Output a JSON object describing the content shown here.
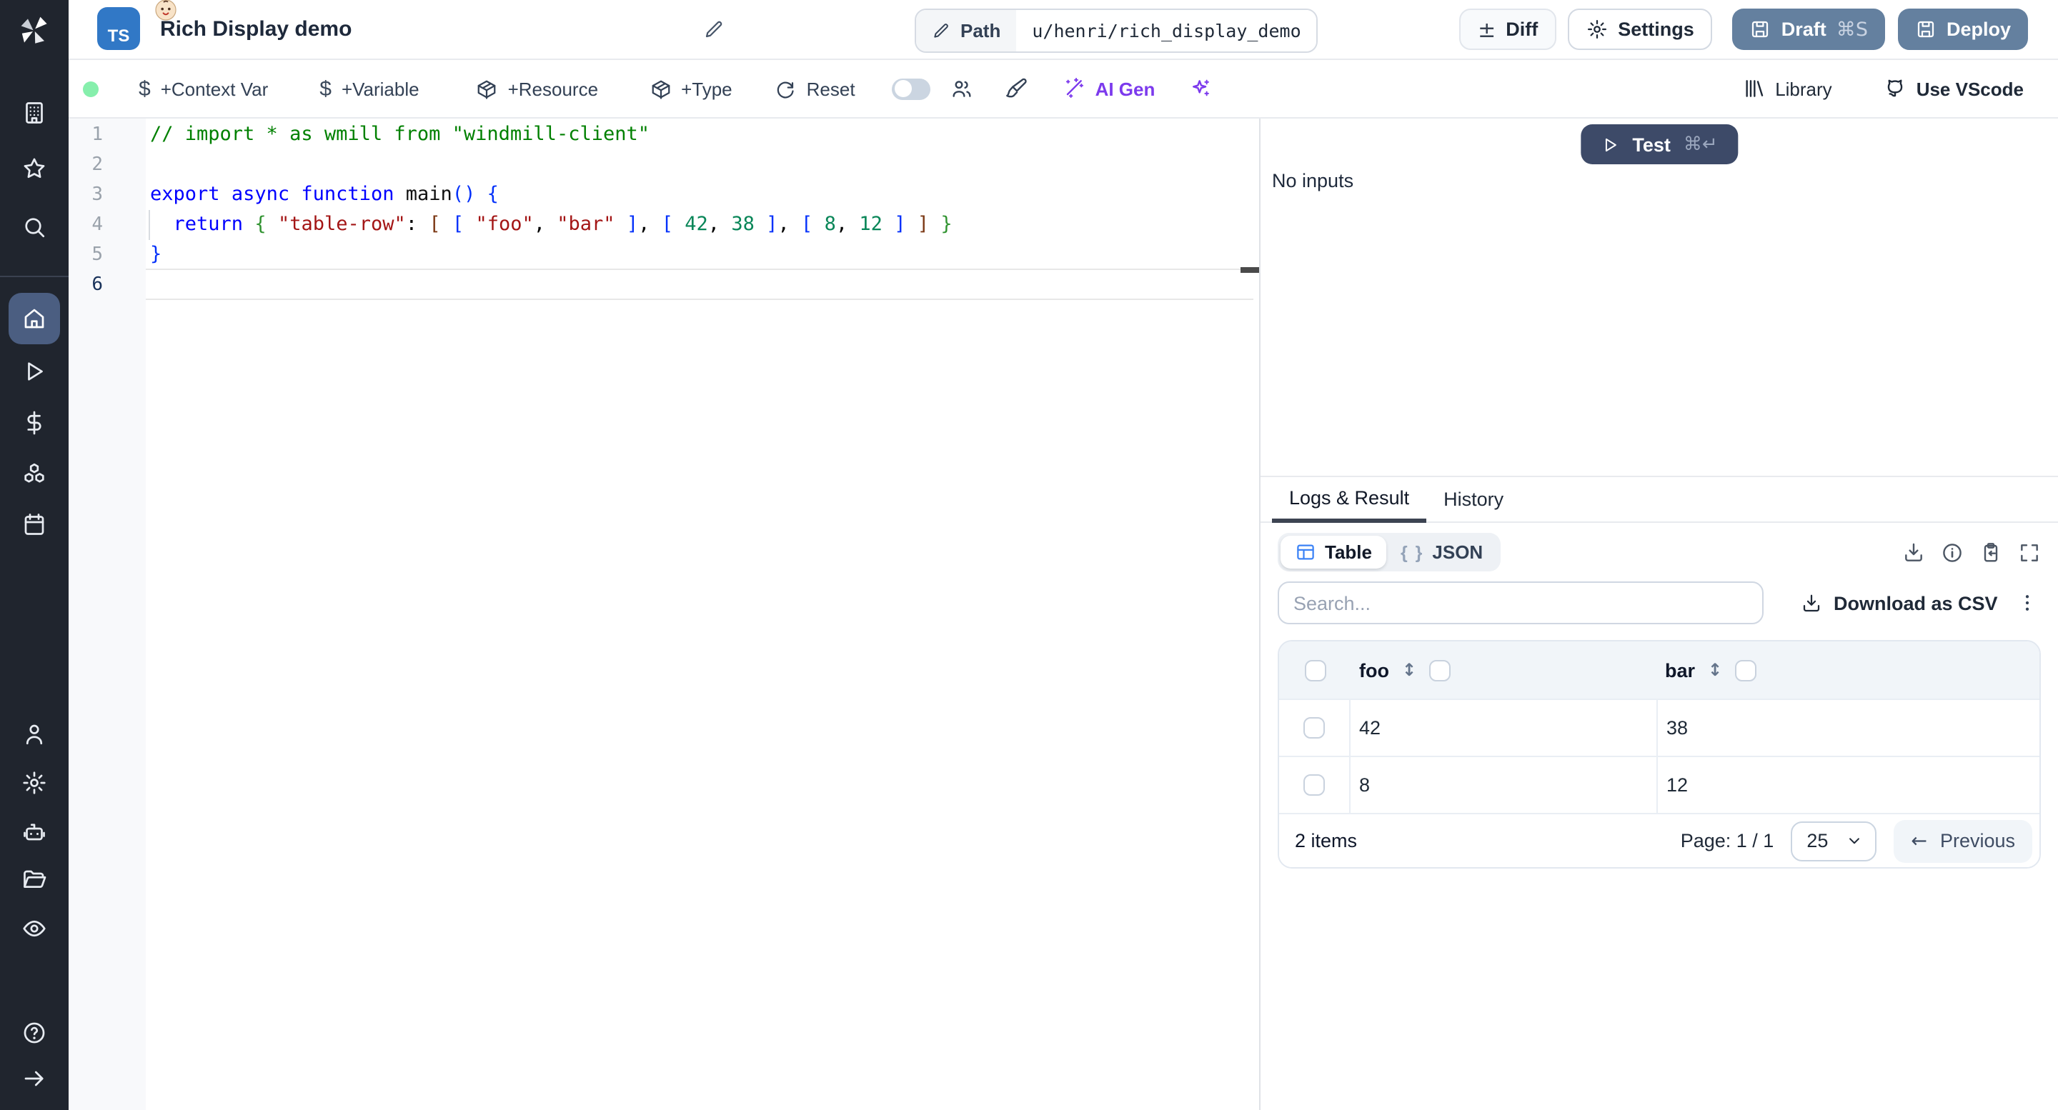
{
  "header": {
    "lang_badge": "TS",
    "title": "Rich Display demo",
    "path_label": "Path",
    "path_value": "u/henri/rich_display_demo",
    "diff_glyph": "±",
    "diff_label": "Diff",
    "settings_label": "Settings",
    "draft_label": "Draft",
    "draft_shortcut": "⌘S",
    "deploy_label": "Deploy"
  },
  "toolbar": {
    "status_dot_color": "#86efac",
    "context_var_label": "+Context Var",
    "variable_label": "+Variable",
    "resource_label": "+Resource",
    "type_label": "+Type",
    "reset_label": "Reset",
    "ai_gen_label": "AI Gen",
    "ai_accent_color": "#7c3aed",
    "library_label": "Library",
    "vscode_label": "Use VScode"
  },
  "editor": {
    "language": "typescript",
    "active_line": 6,
    "lines": [
      {
        "n": 1,
        "tokens": [
          {
            "t": "// import * as wmill from \"windmill-client\"",
            "c": "com"
          }
        ]
      },
      {
        "n": 2,
        "tokens": []
      },
      {
        "n": 3,
        "tokens": [
          {
            "t": "export",
            "c": "kw"
          },
          {
            "t": " "
          },
          {
            "t": "async",
            "c": "kw"
          },
          {
            "t": " "
          },
          {
            "t": "function",
            "c": "kw"
          },
          {
            "t": " "
          },
          {
            "t": "main",
            "c": "fn"
          },
          {
            "t": "(",
            "c": "b1"
          },
          {
            "t": ")",
            "c": "b1"
          },
          {
            "t": " "
          },
          {
            "t": "{",
            "c": "b1"
          }
        ]
      },
      {
        "n": 4,
        "tokens": [
          {
            "t": "  "
          },
          {
            "t": "return",
            "c": "kw"
          },
          {
            "t": " "
          },
          {
            "t": "{",
            "c": "b2"
          },
          {
            "t": " "
          },
          {
            "t": "\"table-row\"",
            "c": "str"
          },
          {
            "t": ":"
          },
          {
            "t": " "
          },
          {
            "t": "[",
            "c": "b3"
          },
          {
            "t": " "
          },
          {
            "t": "[",
            "c": "b1"
          },
          {
            "t": " "
          },
          {
            "t": "\"foo\"",
            "c": "str"
          },
          {
            "t": ","
          },
          {
            "t": " "
          },
          {
            "t": "\"bar\"",
            "c": "str"
          },
          {
            "t": " "
          },
          {
            "t": "]",
            "c": "b1"
          },
          {
            "t": ","
          },
          {
            "t": " "
          },
          {
            "t": "[",
            "c": "b1"
          },
          {
            "t": " "
          },
          {
            "t": "42",
            "c": "num"
          },
          {
            "t": ","
          },
          {
            "t": " "
          },
          {
            "t": "38",
            "c": "num"
          },
          {
            "t": " "
          },
          {
            "t": "]",
            "c": "b1"
          },
          {
            "t": ","
          },
          {
            "t": " "
          },
          {
            "t": "[",
            "c": "b1"
          },
          {
            "t": " "
          },
          {
            "t": "8",
            "c": "num"
          },
          {
            "t": ","
          },
          {
            "t": " "
          },
          {
            "t": "12",
            "c": "num"
          },
          {
            "t": " "
          },
          {
            "t": "]",
            "c": "b1"
          },
          {
            "t": " "
          },
          {
            "t": "]",
            "c": "b3"
          },
          {
            "t": " "
          },
          {
            "t": "}",
            "c": "b2"
          }
        ]
      },
      {
        "n": 5,
        "tokens": [
          {
            "t": "}",
            "c": "b1"
          }
        ]
      },
      {
        "n": 6,
        "tokens": []
      }
    ]
  },
  "run_panel": {
    "test_label": "Test",
    "test_shortcut": "⌘↵",
    "no_inputs": "No inputs"
  },
  "result_panel": {
    "tabs": [
      {
        "label": "Logs & Result",
        "active": true
      },
      {
        "label": "History",
        "active": false
      }
    ],
    "view_toggle": {
      "table_label": "Table",
      "json_glyph": "{ }",
      "json_label": "JSON"
    },
    "search_placeholder": "Search...",
    "download_csv_label": "Download as CSV",
    "table": {
      "columns": [
        "foo",
        "bar"
      ],
      "rows": [
        [
          "42",
          "38"
        ],
        [
          "8",
          "12"
        ]
      ]
    },
    "footer": {
      "items_text": "2 items",
      "page_text": "Page: 1 / 1",
      "page_size": "25",
      "previous_glyph": "←",
      "previous_label": "Previous"
    }
  },
  "glyphs": {
    "sort": "↕"
  }
}
